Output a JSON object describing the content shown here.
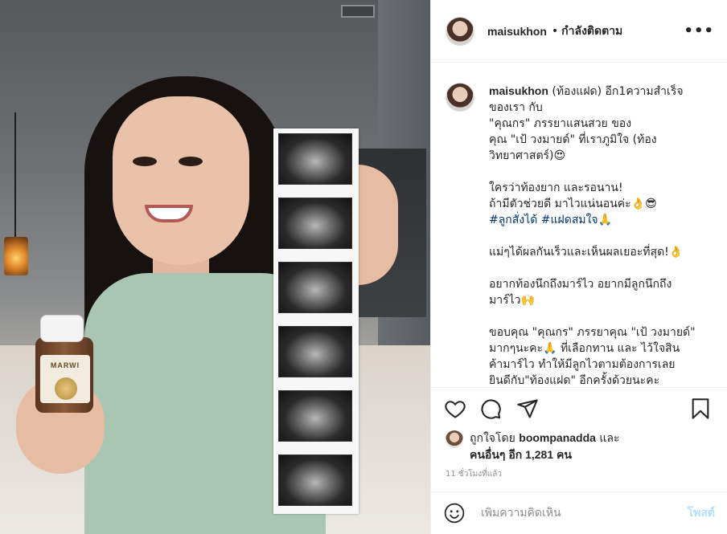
{
  "header": {
    "username": "maisukhon",
    "separator": "•",
    "follow_status": "กำลังติดตาม",
    "more_label": "•••"
  },
  "photo": {
    "bottle_brand": "MARWI"
  },
  "caption": {
    "username": "maisukhon",
    "lines_1": " (ท้องแฝด) อีก1ความสำเร็จ\nของเรา กับ\n\"คุณกร\" ภรรยาแสนสวย ของ\nคุณ \"เป้ วงมายด์\" ที่เราภูมิใจ (ท้อง\nวิทยาศาสตร์)😍\n\nใครว่าท้องยาก และรอนาน!\nถ้ามีตัวช่วยดี มาไวแน่นอนค่ะ👌😎\n",
    "hashtag_1": "#ลูกสั่งได้",
    "hashtag_2": "#แฝดสมใจ",
    "after_hashtags": "🙏\n\nแม่ๆได้ผลกันเร็วและเห็นผลเยอะที่สุด!👌\n\nอยากท้องนึกถึงมาร์ไว อยากมีลูกนึกถึง\nมาร์ไว🙌\n\nขอบคุณ \"คุณกร\" ภรรยาคุณ \"เป้ วงมายด์\"\nมากๆนะคะ🙏 ที่เลือกทาน และ ไว้ใจสิน\nค้ามาร์ไว ทำให้มีลูกไวตามต้องการเลย\nยินดีกับ\"ท้องแฝด\" อีกครั้งด้วยนะคะ"
  },
  "likes": {
    "prefix": "ถูกใจโดย ",
    "liker": "boompanadda",
    "and": " และ",
    "others": "คนอื่นๆ อีก 1,281 คน"
  },
  "timestamp": "11 ชั่วโมงที่แล้ว",
  "comment_box": {
    "placeholder": "เพิ่มความคิดเห็น",
    "post_label": "โพสต์"
  },
  "icons": {
    "heart": "heart-icon",
    "comment": "comment-icon",
    "share": "share-icon",
    "bookmark": "bookmark-icon",
    "emoji": "emoji-icon"
  },
  "colors": {
    "link": "#00376b",
    "post_button_disabled": "#b2dffc",
    "secondary_text": "#8e8e8e",
    "border": "#efefef"
  }
}
